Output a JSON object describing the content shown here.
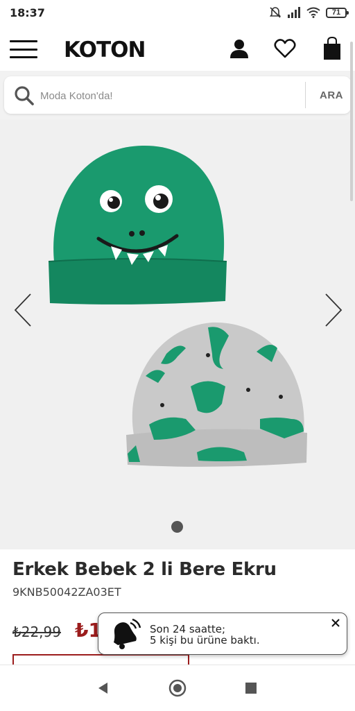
{
  "status_bar": {
    "time": "18:37",
    "battery": "71"
  },
  "header": {
    "logo_text": "KOTON",
    "icons": [
      "menu-icon",
      "user-icon",
      "heart-icon",
      "shopping-bag-icon"
    ]
  },
  "search": {
    "placeholder": "Moda Koton'da!",
    "button_label": "ARA"
  },
  "gallery": {
    "current_slide": 1,
    "total_slides": 1
  },
  "product": {
    "title": "Erkek Bebek 2 li Bere Ekru",
    "sku": "9KNB50042ZA03ET",
    "old_price": "₺22,99",
    "new_price": "₺1"
  },
  "notification": {
    "line1": "Son 24 saatte;",
    "line2": "5 kişi bu ürüne baktı."
  },
  "colors": {
    "brand_dark": "#111111",
    "price_red": "#9b1c1c",
    "hat_green": "#1a9a6e",
    "hat_grey": "#c9c9c9"
  }
}
